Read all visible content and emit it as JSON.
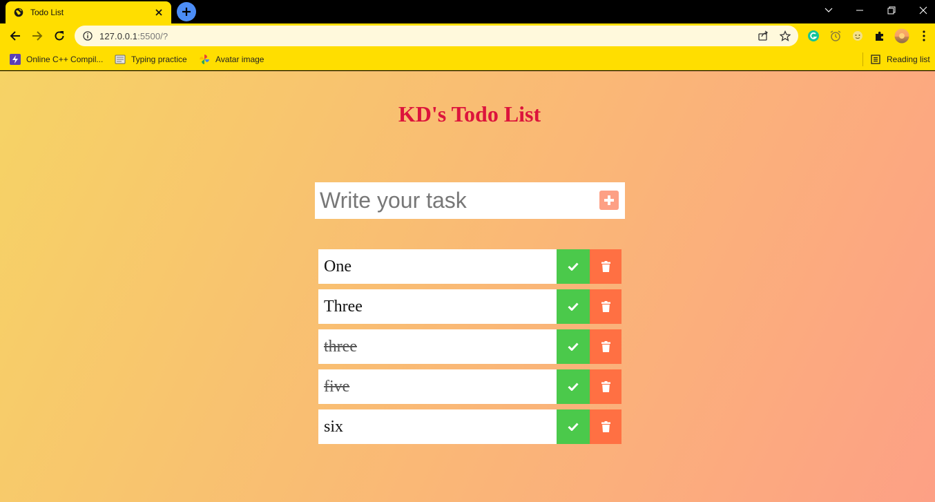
{
  "browser": {
    "tab": {
      "title": "Todo List"
    },
    "address": {
      "host": "127.0.0.1",
      "rest": ":5500/?"
    },
    "bookmarks": [
      {
        "label": "Online C++ Compil...",
        "icon": "lightning-icon"
      },
      {
        "label": "Typing practice",
        "icon": "typing-icon"
      },
      {
        "label": "Avatar image",
        "icon": "pinwheel-icon"
      }
    ],
    "reading_list": "Reading list"
  },
  "app": {
    "title": "KD's Todo List",
    "input": {
      "placeholder": "Write your task",
      "value": ""
    },
    "todos": [
      {
        "text": "One",
        "done": false
      },
      {
        "text": "Three",
        "done": false
      },
      {
        "text": "three",
        "done": true
      },
      {
        "text": "five",
        "done": true
      },
      {
        "text": "six",
        "done": false
      }
    ]
  },
  "colors": {
    "browser_chrome": "#ffde00",
    "title_text": "#dc143c",
    "gradient_start": "#f6d365",
    "gradient_end": "#fda085",
    "check_button": "#4bc94b",
    "trash_button": "#ff7043"
  }
}
